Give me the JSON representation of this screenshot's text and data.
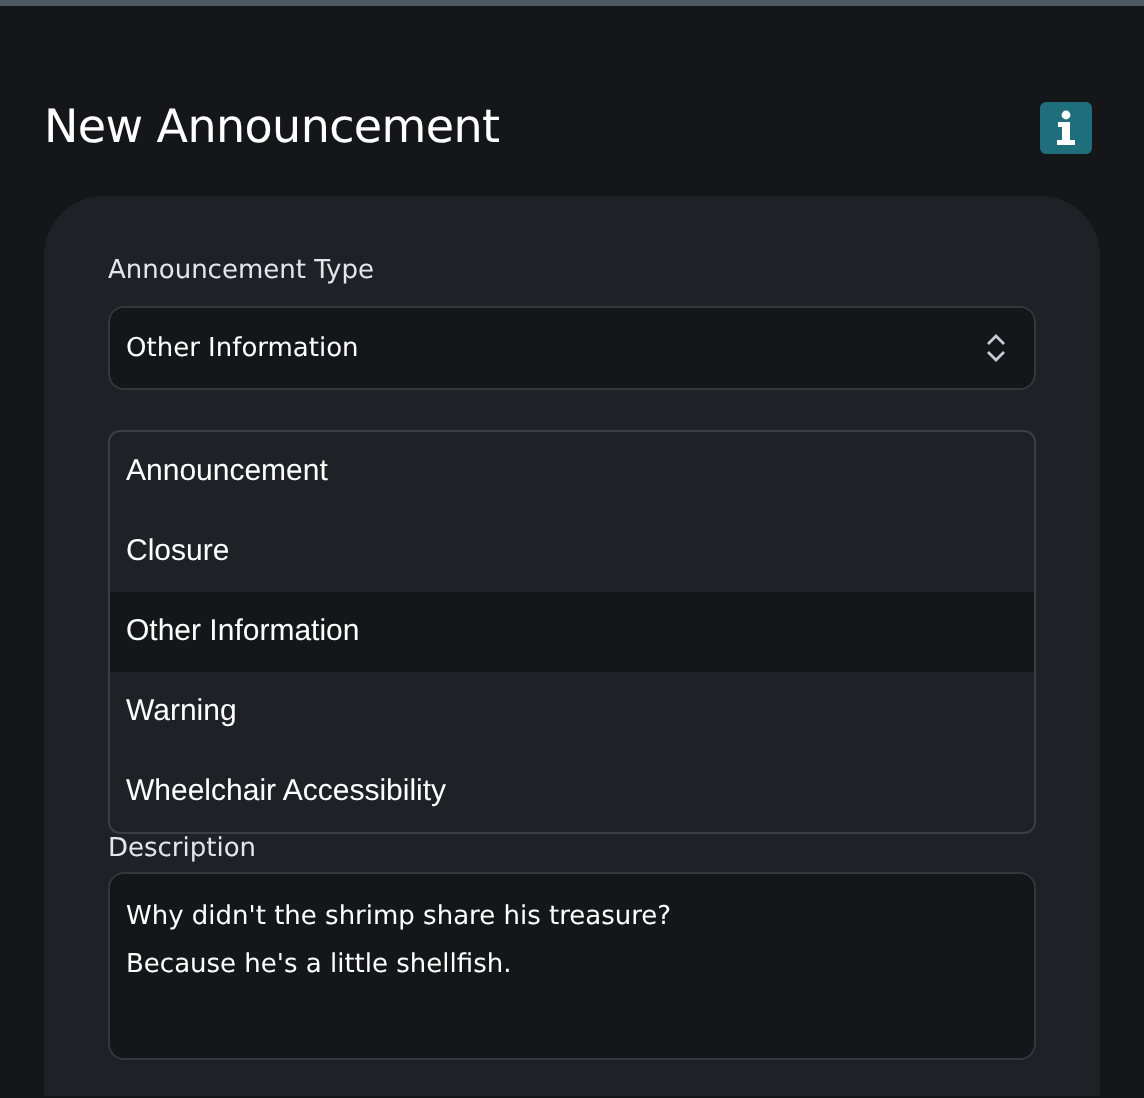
{
  "title": "New Announcement",
  "form": {
    "type_label": "Announcement Type",
    "type_value": "Other Information",
    "options": [
      {
        "label": "Announcement",
        "selected": false
      },
      {
        "label": "Closure",
        "selected": false
      },
      {
        "label": "Other Information",
        "selected": true
      },
      {
        "label": "Warning",
        "selected": false
      },
      {
        "label": "Wheelchair Accessibility",
        "selected": false
      }
    ],
    "description_label": "Description",
    "description_value": "Why didn't the shrimp share his treasure?\nBecause he's a little shellfish."
  }
}
